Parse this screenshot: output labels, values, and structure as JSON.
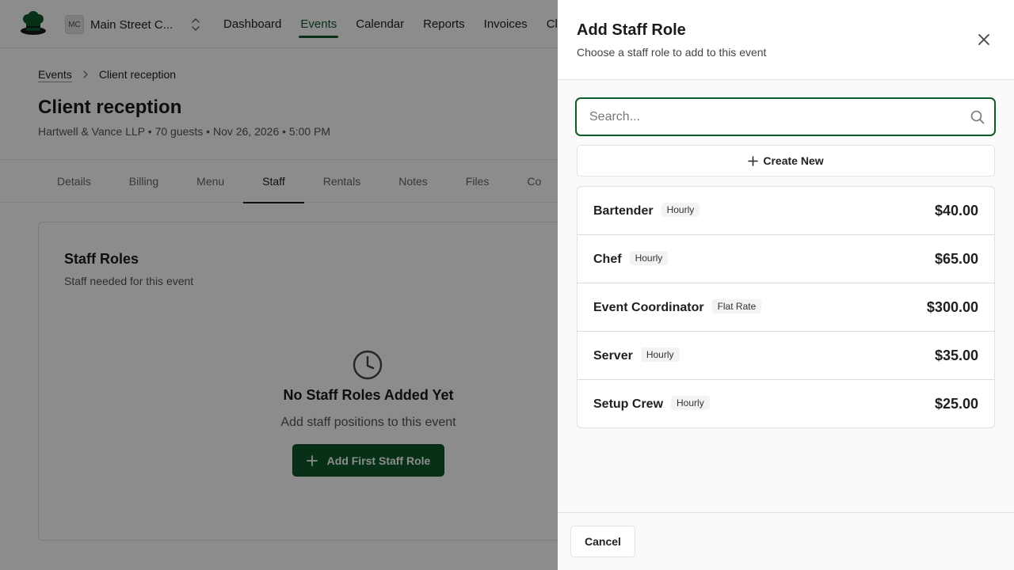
{
  "app": {
    "org": {
      "initials": "MC",
      "name": "Main Street C..."
    },
    "nav": [
      {
        "label": "Dashboard",
        "active": false
      },
      {
        "label": "Events",
        "active": true
      },
      {
        "label": "Calendar",
        "active": false
      },
      {
        "label": "Reports",
        "active": false
      },
      {
        "label": "Invoices",
        "active": false
      },
      {
        "label": "Cl",
        "active": false
      }
    ],
    "breadcrumb": {
      "parent": "Events",
      "current": "Client reception"
    },
    "event": {
      "title": "Client reception",
      "subtitle": "Hartwell & Vance LLP • 70 guests • Nov 26, 2026 • 5:00 PM"
    },
    "tabs": [
      {
        "label": "Details",
        "active": false
      },
      {
        "label": "Billing",
        "active": false
      },
      {
        "label": "Menu",
        "active": false
      },
      {
        "label": "Staff",
        "active": true
      },
      {
        "label": "Rentals",
        "active": false
      },
      {
        "label": "Notes",
        "active": false
      },
      {
        "label": "Files",
        "active": false
      },
      {
        "label": "Co",
        "active": false
      }
    ],
    "staff_card": {
      "title": "Staff Roles",
      "subtitle": "Staff needed for this event",
      "empty_title": "No Staff Roles Added Yet",
      "empty_subtitle": "Add staff positions to this event",
      "add_button": "Add First Staff Role"
    }
  },
  "panel": {
    "title": "Add Staff Role",
    "subtitle": "Choose a staff role to add to this event",
    "search": {
      "placeholder": "Search...",
      "value": ""
    },
    "create_new_label": "Create New",
    "roles": [
      {
        "name": "Bartender",
        "rate_type": "Hourly",
        "price": "$40.00"
      },
      {
        "name": "Chef",
        "rate_type": "Hourly",
        "price": "$65.00"
      },
      {
        "name": "Event Coordinator",
        "rate_type": "Flat Rate",
        "price": "$300.00"
      },
      {
        "name": "Server",
        "rate_type": "Hourly",
        "price": "$35.00"
      },
      {
        "name": "Setup Crew",
        "rate_type": "Hourly",
        "price": "$25.00"
      }
    ],
    "cancel_label": "Cancel"
  },
  "colors": {
    "brand": "#0e5a2a",
    "overlay": "rgba(0,0,0,0.45)"
  }
}
